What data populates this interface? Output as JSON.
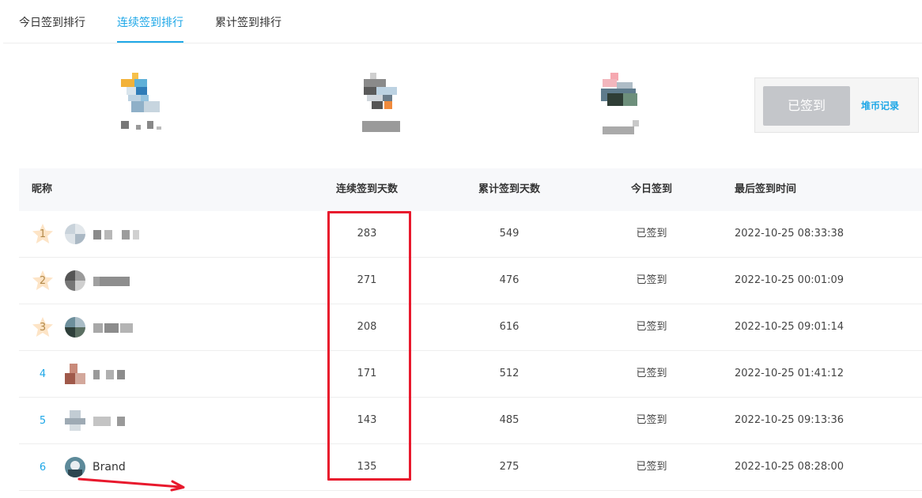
{
  "tabs": [
    {
      "label": "今日签到排行",
      "active": false
    },
    {
      "label": "连续签到排行",
      "active": true
    },
    {
      "label": "累计签到排行",
      "active": false
    }
  ],
  "checkin": {
    "button_label": "已签到",
    "link_label": "堆币记录"
  },
  "table": {
    "headers": {
      "nickname": "昵称",
      "streak": "连续签到天数",
      "total": "累计签到天数",
      "today": "今日签到",
      "last_time": "最后签到时间"
    },
    "rows": [
      {
        "rank": "1",
        "name": "",
        "streak": "283",
        "total": "549",
        "today": "已签到",
        "last_time": "2022-10-25 08:33:38"
      },
      {
        "rank": "2",
        "name": "",
        "streak": "271",
        "total": "476",
        "today": "已签到",
        "last_time": "2022-10-25 00:01:09"
      },
      {
        "rank": "3",
        "name": "",
        "streak": "208",
        "total": "616",
        "today": "已签到",
        "last_time": "2022-10-25 09:01:14"
      },
      {
        "rank": "4",
        "name": "",
        "streak": "171",
        "total": "512",
        "today": "已签到",
        "last_time": "2022-10-25 01:41:12"
      },
      {
        "rank": "5",
        "name": "",
        "streak": "143",
        "total": "485",
        "today": "已签到",
        "last_time": "2022-10-25 09:13:36"
      },
      {
        "rank": "6",
        "name": "Brand",
        "streak": "135",
        "total": "275",
        "today": "已签到",
        "last_time": "2022-10-25 08:28:00"
      }
    ]
  },
  "colors": {
    "accent": "#1ea7e7",
    "annotation_red": "#e8192d",
    "medal_star": "#fde4c6",
    "button_gray": "#c4c6ca"
  },
  "icons": {
    "medal": "star-medal-icon",
    "avatar": "blurred-avatar",
    "annotation": "red-arrow-annotation"
  }
}
